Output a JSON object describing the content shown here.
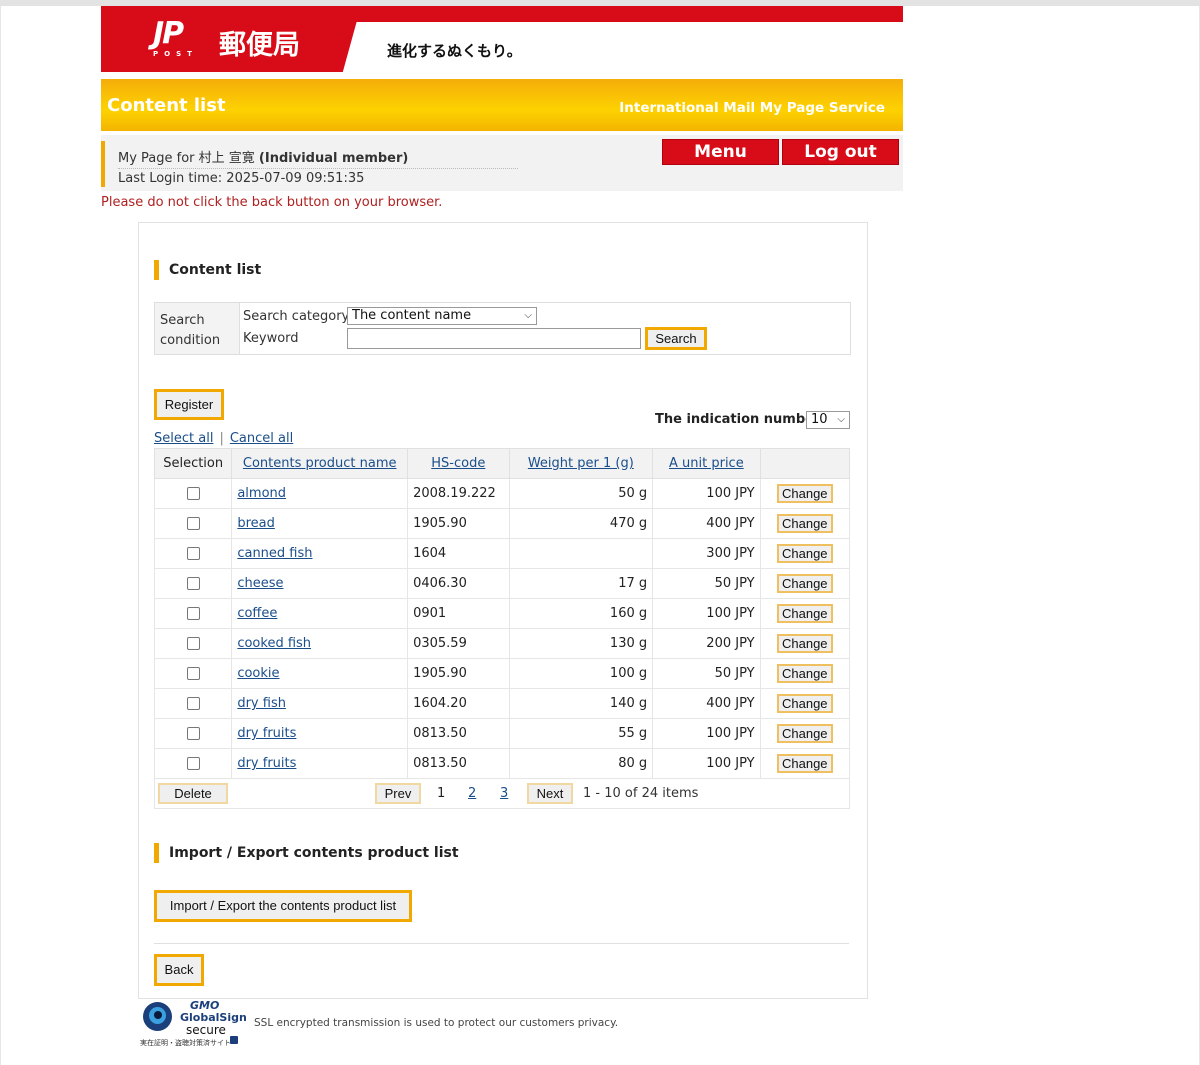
{
  "header": {
    "logo_jp": "JP",
    "logo_post": "POST",
    "logo_name": "郵便局",
    "tagline": "進化するぬくもり。",
    "page_title": "Content list",
    "service_name": "International Mail My Page Service"
  },
  "user": {
    "mypage_prefix": "My Page for 村上 宣寛 ",
    "member_type": "(Individual member)",
    "last_login": "Last Login time: 2025-07-09 09:51:35",
    "menu_label": "Menu",
    "logout_label": "Log out"
  },
  "warning": "Please do not click the back button on your browser.",
  "content_list": {
    "section_title": "Content list",
    "search": {
      "condition_label": "Search condition",
      "category_label": "Search category",
      "category_value": "The content name",
      "keyword_label": "Keyword",
      "keyword_value": "",
      "search_button": "Search"
    },
    "register_button": "Register",
    "indication_label": "The indication number",
    "indication_value": "10",
    "select_all": "Select all",
    "cancel_all": "Cancel all",
    "columns": [
      "Selection",
      "Contents product name",
      "HS-code",
      "Weight per 1 (g)",
      "A unit price",
      ""
    ],
    "rows": [
      {
        "name": "almond",
        "hs": "2008.19.222",
        "weight": "50 g",
        "price": "100 JPY",
        "action": "Change"
      },
      {
        "name": "bread",
        "hs": "1905.90",
        "weight": "470 g",
        "price": "400 JPY",
        "action": "Change"
      },
      {
        "name": "canned fish",
        "hs": "1604",
        "weight": "",
        "price": "300 JPY",
        "action": "Change"
      },
      {
        "name": "cheese",
        "hs": "0406.30",
        "weight": "17 g",
        "price": "50 JPY",
        "action": "Change"
      },
      {
        "name": "coffee",
        "hs": "0901",
        "weight": "160 g",
        "price": "100 JPY",
        "action": "Change"
      },
      {
        "name": "cooked fish",
        "hs": "0305.59",
        "weight": "130 g",
        "price": "200 JPY",
        "action": "Change"
      },
      {
        "name": "cookie",
        "hs": "1905.90",
        "weight": "100 g",
        "price": "50 JPY",
        "action": "Change"
      },
      {
        "name": "dry fish",
        "hs": "1604.20",
        "weight": "140 g",
        "price": "400 JPY",
        "action": "Change"
      },
      {
        "name": "dry fruits",
        "hs": "0813.50",
        "weight": "55 g",
        "price": "100 JPY",
        "action": "Change"
      },
      {
        "name": "dry fruits",
        "hs": "0813.50",
        "weight": "80 g",
        "price": "100 JPY",
        "action": "Change"
      }
    ],
    "delete_button": "Delete",
    "prev_button": "Prev",
    "next_button": "Next",
    "pages": [
      "1",
      "2",
      "3"
    ],
    "page_info": "1  -  10 of 24 items"
  },
  "import_export": {
    "section_title": "Import / Export contents product list",
    "button": "Import / Export the contents product list"
  },
  "back_button": "Back",
  "footer": {
    "seal_gmo": "GMO",
    "seal_globalsign": "GlobalSign",
    "seal_secure": "secure",
    "seal_note": "実在証明・盗聴対策済サイト",
    "ssl_text": "SSL encrypted transmission is used to protect our customers privacy."
  },
  "colors": {
    "brand_red": "#d80c18",
    "accent_orange": "#f1a800",
    "link_blue": "#1a4e8a",
    "warning_red": "#b02020"
  }
}
